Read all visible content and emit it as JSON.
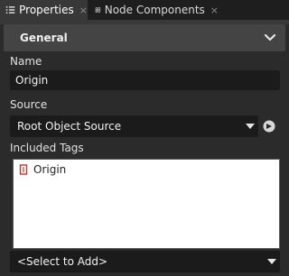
{
  "tabs": [
    {
      "label": "Properties",
      "icon": "properties-list-icon",
      "active": true,
      "close": "×"
    },
    {
      "label": "Node Components",
      "icon": "node-components-icon",
      "active": false,
      "close": "×"
    }
  ],
  "group": {
    "title": "General",
    "icon": "chevron-down-icon"
  },
  "name": {
    "label": "Name",
    "value": "Origin"
  },
  "source": {
    "label": "Source",
    "value": "Root Object Source",
    "reset_icon": "reset-arrow-icon"
  },
  "tags": {
    "label": "Included Tags",
    "items": [
      {
        "label": "Origin",
        "icon": "tag-icon"
      }
    ],
    "select_placeholder": "<Select to Add>"
  },
  "colors": {
    "background": "#2b2b2b",
    "field": "#1b1b1b",
    "list_bg": "#ffffff",
    "tag_icon": "#c0392b"
  }
}
